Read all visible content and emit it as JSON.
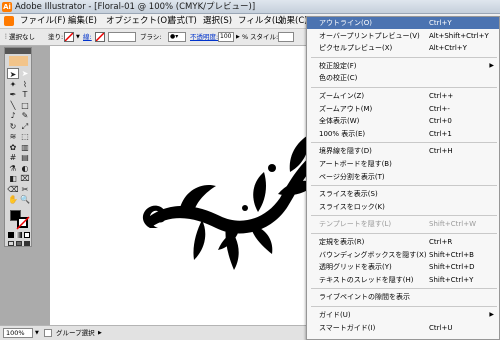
{
  "window": {
    "app_icon_letter": "Ai",
    "title": "Adobe Illustrator - [Floral-01 @ 100% (CMYK/プレビュー)]"
  },
  "menubar": {
    "items": [
      "ファイル(F)",
      "編集(E)",
      "オブジェクト(O)",
      "書式(T)",
      "選択(S)",
      "フィルタ(L)",
      "効果(C)"
    ]
  },
  "controlbar": {
    "selection_label": "選択なし",
    "fill_label": "塗り:",
    "stroke_label": "線:",
    "brush_label": "ブラシ:",
    "opacity_link": "不透明度:",
    "opacity_value": "100",
    "percent": "%",
    "style_label": "スタイル:"
  },
  "tools": {
    "icons": [
      "selection-tool-icon",
      "direct-selection-tool-icon",
      "magic-wand-icon",
      "lasso-icon",
      "pen-tool-icon",
      "type-tool-icon",
      "line-tool-icon",
      "rectangle-tool-icon",
      "paintbrush-icon",
      "pencil-icon",
      "rotate-tool-icon",
      "scale-tool-icon",
      "warp-tool-icon",
      "free-transform-icon",
      "symbol-sprayer-icon",
      "graph-tool-icon",
      "mesh-tool-icon",
      "gradient-tool-icon",
      "eyedropper-icon",
      "blend-tool-icon",
      "live-paint-icon",
      "slice-tool-icon",
      "eraser-icon",
      "scissors-icon",
      "hand-tool-icon",
      "zoom-tool-icon"
    ]
  },
  "status": {
    "zoom": "100%",
    "tool_name": "グループ選択"
  },
  "view_menu": {
    "items": [
      {
        "label": "アウトライン(O)",
        "shortcut": "Ctrl+Y",
        "highlighted": true
      },
      {
        "label": "オーバープリントプレビュー(V)",
        "shortcut": "Alt+Shift+Ctrl+Y"
      },
      {
        "label": "ピクセルプレビュー(X)",
        "shortcut": "Alt+Ctrl+Y"
      },
      {
        "label": "校正設定(F)",
        "shortcut": "",
        "submenu": true
      },
      {
        "label": "色の校正(C)",
        "shortcut": ""
      },
      {
        "label": "ズームイン(Z)",
        "shortcut": "Ctrl++"
      },
      {
        "label": "ズームアウト(M)",
        "shortcut": "Ctrl+-"
      },
      {
        "label": "全体表示(W)",
        "shortcut": "Ctrl+0"
      },
      {
        "label": "100% 表示(E)",
        "shortcut": "Ctrl+1"
      },
      {
        "label": "境界線を隠す(D)",
        "shortcut": "Ctrl+H"
      },
      {
        "label": "アートボードを隠す(B)",
        "shortcut": ""
      },
      {
        "label": "ページ分割を表示(T)",
        "shortcut": ""
      },
      {
        "label": "スライスを表示(S)",
        "shortcut": ""
      },
      {
        "label": "スライスをロック(K)",
        "shortcut": ""
      },
      {
        "label": "テンプレートを隠す(L)",
        "shortcut": "Shift+Ctrl+W",
        "disabled": true
      },
      {
        "label": "定規を表示(R)",
        "shortcut": "Ctrl+R"
      },
      {
        "label": "バウンディングボックスを隠す(X)",
        "shortcut": "Shift+Ctrl+B"
      },
      {
        "label": "透明グリッドを表示(Y)",
        "shortcut": "Shift+Ctrl+D"
      },
      {
        "label": "テキストのスレッドを隠す(H)",
        "shortcut": "Shift+Ctrl+Y"
      },
      {
        "label": "ライブペイントの隙間を表示",
        "shortcut": ""
      },
      {
        "label": "ガイド(U)",
        "shortcut": "",
        "submenu": true
      },
      {
        "label": "スマートガイド(I)",
        "shortcut": "Ctrl+U"
      }
    ]
  },
  "colors": {
    "menu_highlight": "#4b73b1",
    "app_accent": "#ff7a00"
  }
}
